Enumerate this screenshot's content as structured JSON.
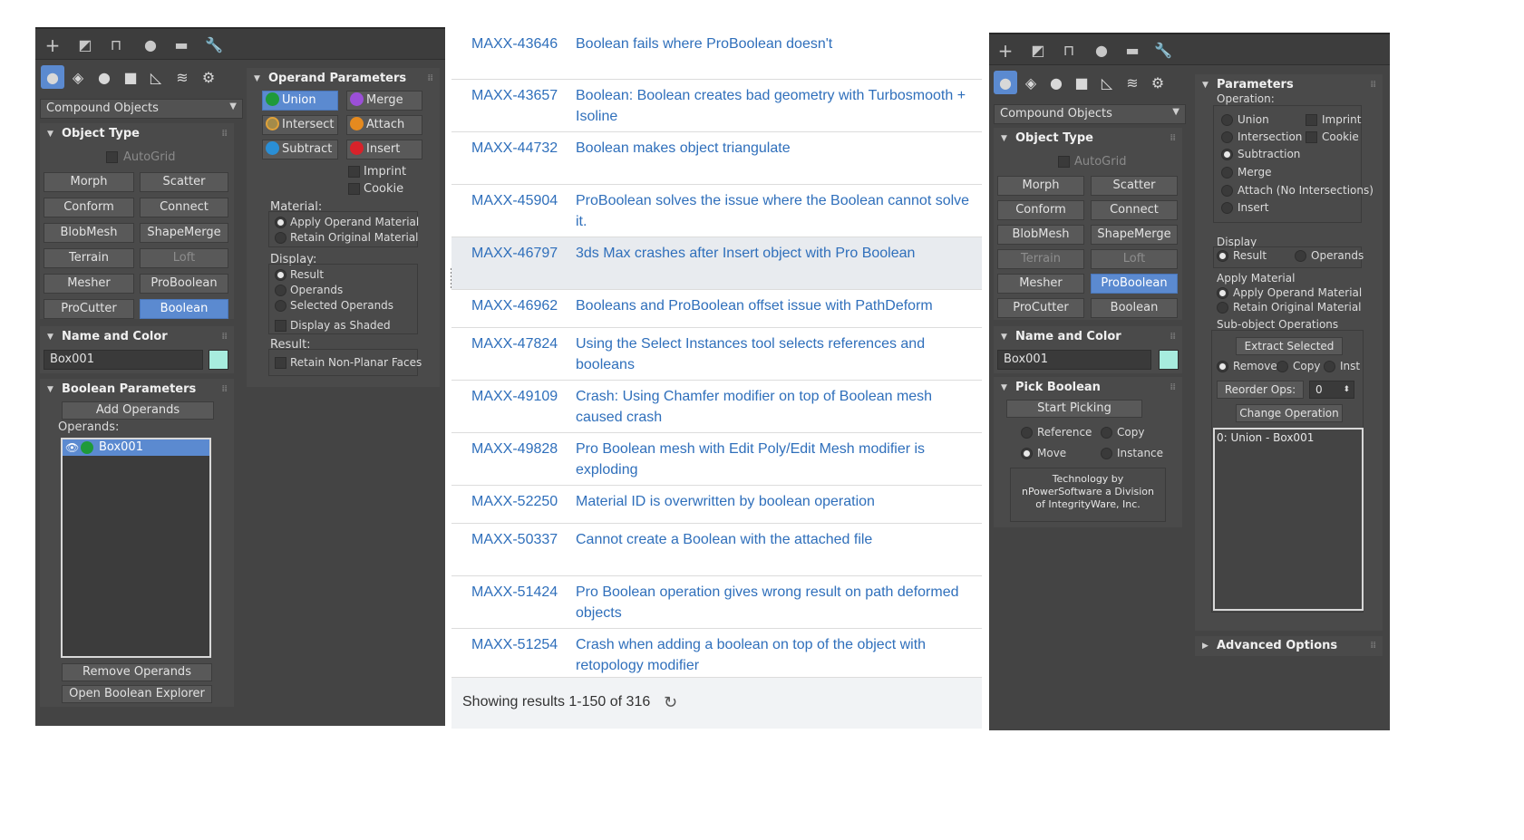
{
  "left_panel": {
    "dropdown": "Compound Objects",
    "object_type": {
      "title": "Object Type",
      "autogrid": "AutoGrid",
      "buttons": [
        "Morph",
        "Scatter",
        "Conform",
        "Connect",
        "BlobMesh",
        "ShapeMerge",
        "Terrain",
        "Loft",
        "Mesher",
        "ProBoolean",
        "ProCutter",
        "Boolean"
      ]
    },
    "name_color": {
      "title": "Name and Color",
      "name": "Box001",
      "color": "#a7ecde"
    },
    "boolean_params": {
      "title": "Boolean Parameters",
      "add_operands": "Add Operands",
      "operands_label": "Operands:",
      "operand_item": "Box001",
      "remove_operands": "Remove Operands",
      "open_explorer": "Open Boolean Explorer"
    },
    "operand_params": {
      "title": "Operand Parameters",
      "ops": {
        "union": "Union",
        "merge": "Merge",
        "intersect": "Intersect",
        "attach": "Attach",
        "subtract": "Subtract",
        "insert": "Insert"
      },
      "imprint": "Imprint",
      "cookie": "Cookie",
      "material_label": "Material:",
      "apply_operand_material": "Apply Operand Material",
      "retain_original_material": "Retain Original Material",
      "display_label": "Display:",
      "result": "Result",
      "operands": "Operands",
      "selected_operands": "Selected Operands",
      "display_as_shaded": "Display as Shaded",
      "result_label": "Result:",
      "retain_nonplanar": "Retain Non-Planar Faces"
    }
  },
  "issues": {
    "rows": [
      {
        "id": "MAXX-43646",
        "title": "Boolean fails where ProBoolean doesn't"
      },
      {
        "id": "MAXX-43657",
        "title": "Boolean: Boolean creates bad geometry with Turbosmooth + Isoline"
      },
      {
        "id": "MAXX-44732",
        "title": "Boolean makes object triangulate"
      },
      {
        "id": "MAXX-45904",
        "title": "ProBoolean solves the issue where the Boolean cannot solve it."
      },
      {
        "id": "MAXX-46797",
        "title": "3ds Max crashes after Insert object with Pro Boolean"
      },
      {
        "id": "MAXX-46962",
        "title": "Booleans and ProBoolean offset issue with PathDeform"
      },
      {
        "id": "MAXX-47824",
        "title": "Using the Select Instances tool selects references and booleans"
      },
      {
        "id": "MAXX-49109",
        "title": "Crash: Using Chamfer modifier on top of Boolean mesh caused crash"
      },
      {
        "id": "MAXX-49828",
        "title": "Pro Boolean mesh with Edit Poly/Edit Mesh modifier is exploding"
      },
      {
        "id": "MAXX-52250",
        "title": "Material ID is overwritten by boolean operation"
      },
      {
        "id": "MAXX-50337",
        "title": "Cannot create a Boolean with the attached file"
      },
      {
        "id": "MAXX-51424",
        "title": "Pro Boolean operation gives wrong result on path deformed objects"
      },
      {
        "id": "MAXX-51254",
        "title": "Crash when adding a boolean on top of the object with retopology modifier"
      }
    ],
    "footer": "Showing results 1-150 of 316"
  },
  "right_panel": {
    "dropdown": "Compound Objects",
    "object_type": {
      "title": "Object Type",
      "autogrid": "AutoGrid",
      "buttons": [
        "Morph",
        "Scatter",
        "Conform",
        "Connect",
        "BlobMesh",
        "ShapeMerge",
        "Terrain",
        "Loft",
        "Mesher",
        "ProBoolean",
        "ProCutter",
        "Boolean"
      ]
    },
    "name_color": {
      "title": "Name and Color",
      "name": "Box001",
      "color": "#a7ecde"
    },
    "pick_boolean": {
      "title": "Pick Boolean",
      "start_picking": "Start Picking",
      "reference": "Reference",
      "copy": "Copy",
      "move": "Move",
      "instance": "Instance",
      "credit_1": "Technology by",
      "credit_2": "nPowerSoftware a Division",
      "credit_3": "of IntegrityWare, Inc."
    },
    "parameters": {
      "title": "Parameters",
      "operation_label": "Operation:",
      "union": "Union",
      "intersection": "Intersection",
      "subtraction": "Subtraction",
      "merge": "Merge",
      "attach": "Attach (No Intersections)",
      "insert": "Insert",
      "imprint": "Imprint",
      "cookie": "Cookie",
      "display_label": "Display",
      "result": "Result",
      "operands": "Operands",
      "apply_material_label": "Apply Material",
      "apply_operand_material": "Apply Operand Material",
      "retain_original_material": "Retain Original Material",
      "subobject_label": "Sub-object Operations",
      "extract_selected": "Extract Selected",
      "remove": "Remove",
      "copy": "Copy",
      "inst": "Inst",
      "reorder_ops": "Reorder Ops:",
      "reorder_value": "0",
      "change_operation": "Change Operation",
      "list_item": "0: Union - Box001",
      "advanced_options": "Advanced Options"
    }
  }
}
